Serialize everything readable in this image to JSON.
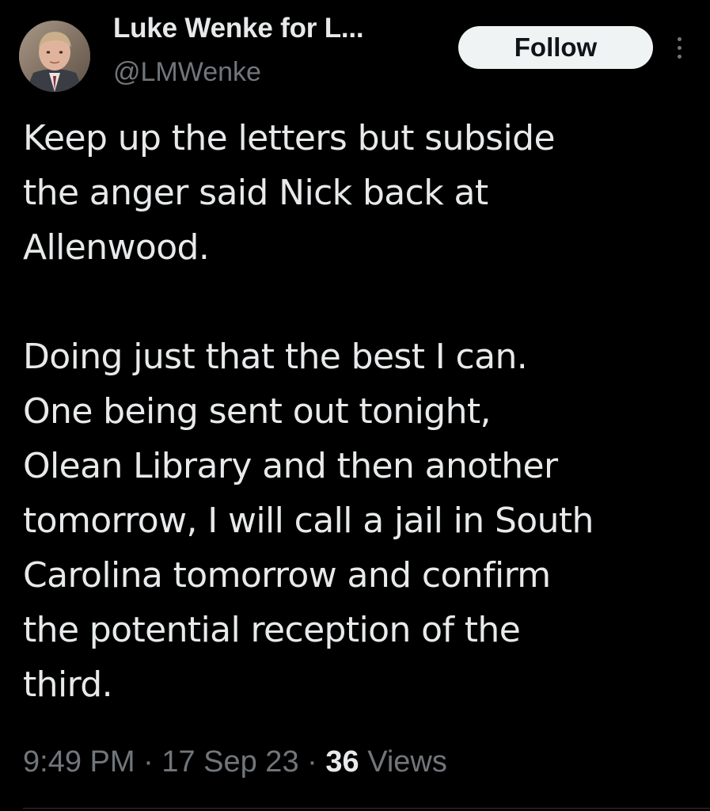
{
  "author": {
    "display_name": "Luke Wenke for L...",
    "handle": "@LMWenke",
    "avatar_alt": "profile-photo"
  },
  "actions": {
    "follow_label": "Follow",
    "more_icon": "more-vertical-icon"
  },
  "tweet": {
    "paragraphs": [
      "Keep up the letters but subside\nthe anger said Nick back at\nAllenwood.",
      "Doing just that the best I can.\nOne being sent out tonight,\nOlean Library and then another\ntomorrow, I will call a jail in South\nCarolina tomorrow and confirm\nthe potential reception of the\nthird."
    ]
  },
  "meta": {
    "time": "9:49 PM",
    "separator": " · ",
    "date": "17 Sep 23",
    "views_count": "36",
    "views_label": " Views"
  },
  "colors": {
    "background": "#000000",
    "text_primary": "#e7e9ea",
    "text_secondary": "#71767b",
    "follow_bg": "#eff3f4",
    "divider": "#2f3336"
  }
}
